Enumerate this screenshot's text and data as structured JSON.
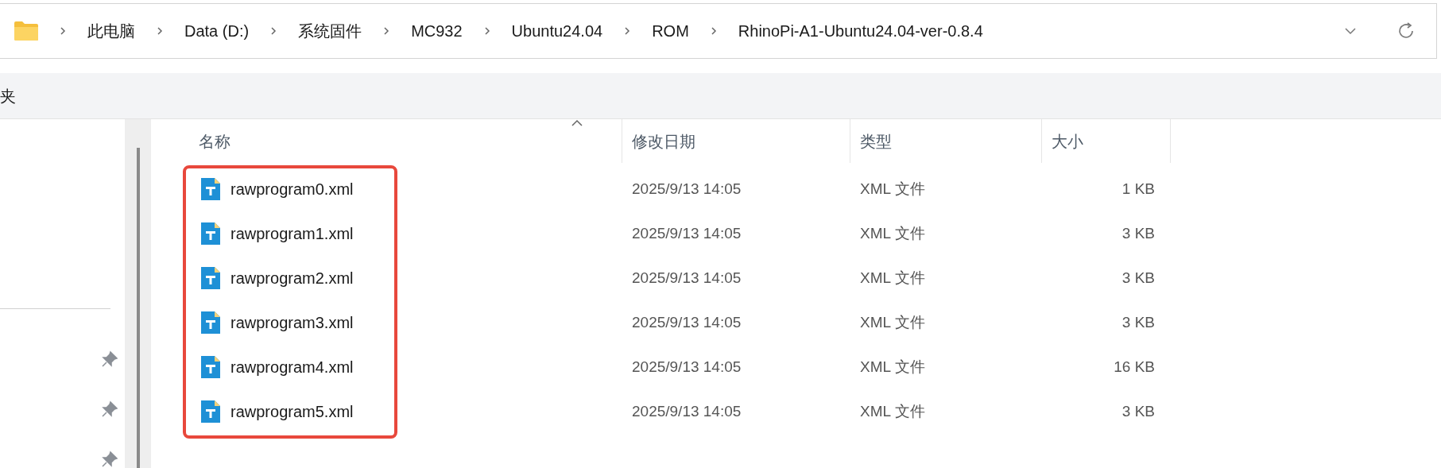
{
  "address_bar": {
    "crumbs": [
      "此电脑",
      "Data (D:)",
      "系统固件",
      "MC932",
      "Ubuntu24.04",
      "ROM",
      "RhinoPi-A1-Ubuntu24.04-ver-0.8.4"
    ]
  },
  "toolbar": {
    "label": "夹"
  },
  "columns": [
    {
      "label": "名称",
      "sorted": true
    },
    {
      "label": "修改日期",
      "sorted": false
    },
    {
      "label": "类型",
      "sorted": false
    },
    {
      "label": "大小",
      "sorted": false
    }
  ],
  "files": [
    {
      "name": "rawprogram0.xml",
      "modified": "2025/9/13 14:05",
      "type": "XML 文件",
      "size": "1 KB"
    },
    {
      "name": "rawprogram1.xml",
      "modified": "2025/9/13 14:05",
      "type": "XML 文件",
      "size": "3 KB"
    },
    {
      "name": "rawprogram2.xml",
      "modified": "2025/9/13 14:05",
      "type": "XML 文件",
      "size": "3 KB"
    },
    {
      "name": "rawprogram3.xml",
      "modified": "2025/9/13 14:05",
      "type": "XML 文件",
      "size": "3 KB"
    },
    {
      "name": "rawprogram4.xml",
      "modified": "2025/9/13 14:05",
      "type": "XML 文件",
      "size": "16 KB"
    },
    {
      "name": "rawprogram5.xml",
      "modified": "2025/9/13 14:05",
      "type": "XML 文件",
      "size": "3 KB"
    }
  ]
}
